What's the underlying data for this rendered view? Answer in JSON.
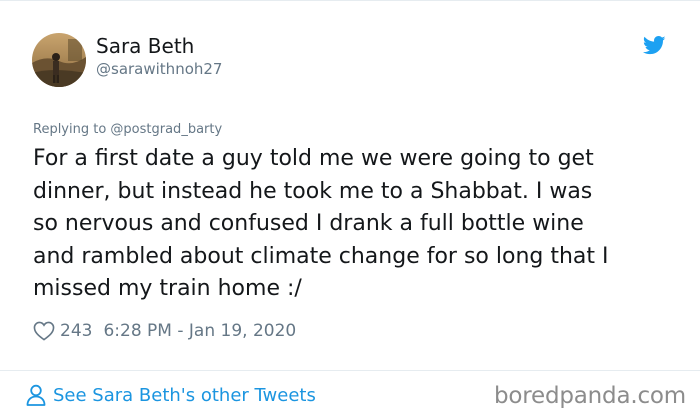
{
  "user": {
    "display_name": "Sara Beth",
    "handle": "@sarawithnoh27"
  },
  "tweet": {
    "replying_to": "Replying to @postgrad_barty",
    "text": "For a first date a guy told me we were going to get\ndinner, but instead he took me to a Shabbat. I was\nso nervous and confused I drank a full bottle wine\nand rambled about climate change for so long that I\nmissed my train home :/",
    "likes": "243",
    "timestamp": "6:28 PM - Jan 19, 2020"
  },
  "footer": {
    "see_more_label": "See Sara Beth's other Tweets"
  },
  "watermark": "boredpanda.com",
  "icons": {
    "brand": "twitter-bird-icon",
    "like": "heart-icon",
    "profile": "person-icon"
  },
  "colors": {
    "twitter_blue": "#1da1f2",
    "link_blue": "#1b95e0",
    "secondary_text": "#657786",
    "primary_text": "#14171a"
  }
}
